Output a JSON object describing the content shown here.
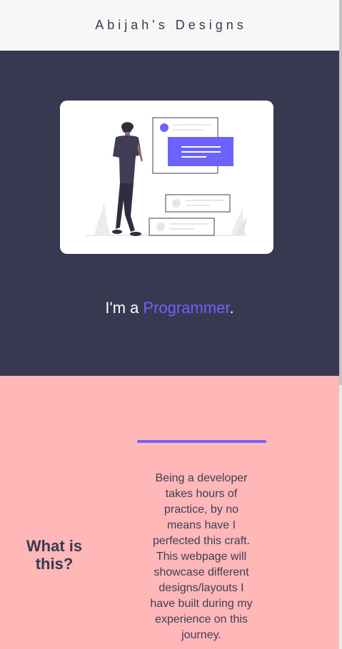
{
  "header": {
    "brand": "Abijah's Designs"
  },
  "hero": {
    "illustration_icon": "person-viewing-content-cards-illustration",
    "tagline_prefix": "I'm a",
    "tagline_role": "Programmer",
    "tagline_suffix": "."
  },
  "about": {
    "heading": "What is this?",
    "body": "Being a developer takes hours of practice, by no means have I perfected this craft. This webpage will showcase different designs/layouts I have built during my experience on this journey."
  },
  "colors": {
    "header_bg": "#f7f7f7",
    "hero_bg": "#383850",
    "accent": "#6c63ff",
    "about_bg": "#ffb7b7",
    "text_dark": "#393950"
  }
}
